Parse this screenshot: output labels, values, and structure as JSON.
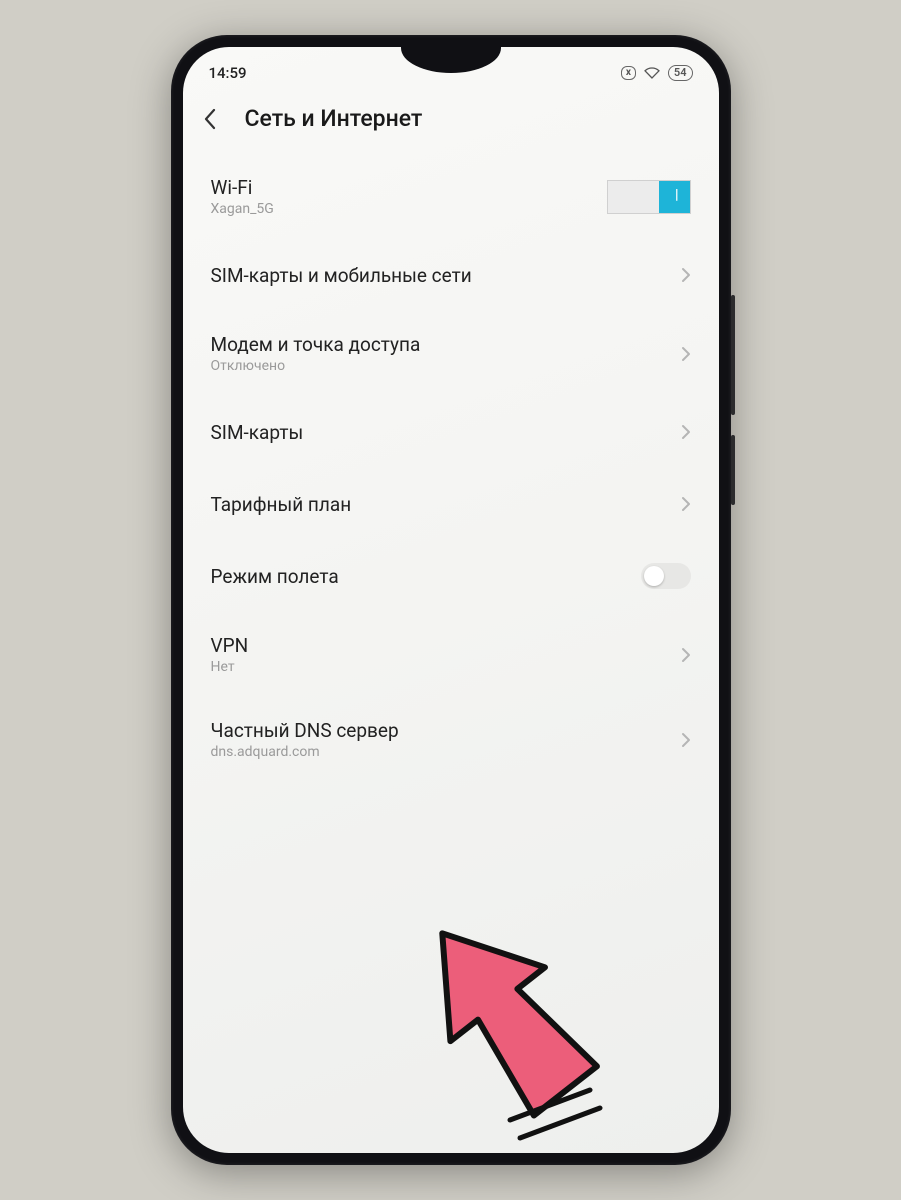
{
  "status": {
    "time": "14:59",
    "battery": "54",
    "cancel_badge": "x"
  },
  "header": {
    "title": "Сеть и Интернет"
  },
  "rows": {
    "wifi": {
      "label": "Wi-Fi",
      "sub": "Xagan_5G"
    },
    "sim_networks": {
      "label": "SIM-карты и мобильные сети"
    },
    "hotspot": {
      "label": "Модем и точка доступа",
      "sub": "Отключено"
    },
    "sim_cards": {
      "label": "SIM-карты"
    },
    "data_plan": {
      "label": "Тарифный план"
    },
    "airplane": {
      "label": "Режим полета"
    },
    "vpn": {
      "label": "VPN",
      "sub": "Нет"
    },
    "private_dns": {
      "label": "Частный DNS сервер",
      "sub": "dns.adquard.com"
    }
  }
}
